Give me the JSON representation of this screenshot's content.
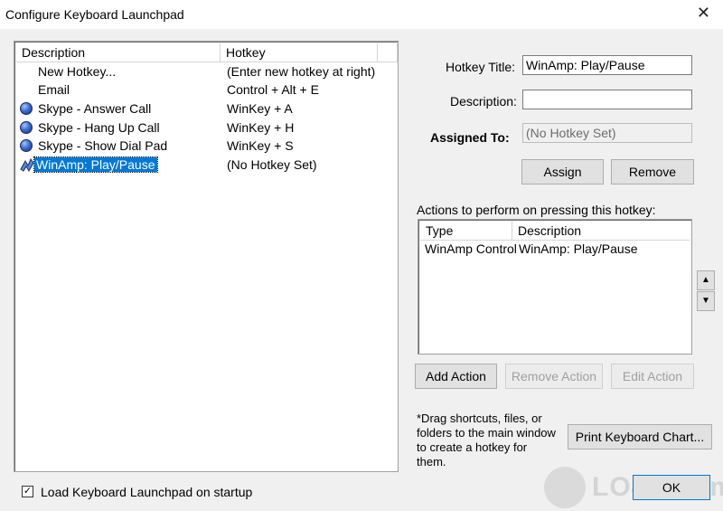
{
  "window": {
    "title": "Configure Keyboard Launchpad",
    "close_glyph": "✕"
  },
  "list": {
    "headers": [
      "Description",
      "Hotkey"
    ],
    "rows": [
      {
        "icon": "none",
        "description": "New Hotkey...",
        "hotkey": "(Enter new hotkey at right)"
      },
      {
        "icon": "none",
        "description": "Email",
        "hotkey": "Control + Alt + E"
      },
      {
        "icon": "globe-icon",
        "description": "Skype - Answer Call",
        "hotkey": "WinKey + A"
      },
      {
        "icon": "globe-icon",
        "description": "Skype - Hang Up Call",
        "hotkey": "WinKey + H"
      },
      {
        "icon": "globe-icon",
        "description": "Skype - Show Dial Pad",
        "hotkey": "WinKey + S"
      },
      {
        "icon": "winamp-icon",
        "description": "WinAmp: Play/Pause",
        "hotkey": "(No Hotkey Set)",
        "selected": true
      }
    ]
  },
  "form": {
    "hotkey_title_label": "Hotkey Title:",
    "hotkey_title_value": "WinAmp: Play/Pause",
    "description_label": "Description:",
    "description_value": "",
    "assigned_to_label": "Assigned To:",
    "assigned_to_value": "(No Hotkey Set)",
    "assign_button": "Assign",
    "remove_button": "Remove"
  },
  "actions": {
    "caption": "Actions to perform on pressing this hotkey:",
    "headers": [
      "Type",
      "Description"
    ],
    "rows": [
      {
        "type": "WinAmp Control",
        "description": "WinAmp: Play/Pause"
      }
    ],
    "add_button": "Add Action",
    "remove_button": "Remove Action",
    "edit_button": "Edit Action",
    "up_glyph": "▲",
    "down_glyph": "▼"
  },
  "hint": {
    "line1": "*Drag shortcuts, files, or",
    "line2": "folders to the main window",
    "line3": "to create a hotkey for",
    "line4": "them."
  },
  "print_button": "Print Keyboard Chart...",
  "ok_button": "OK",
  "startup": {
    "label": "Load Keyboard Launchpad on startup",
    "checked": true,
    "check_glyph": "✓"
  },
  "watermark": {
    "text": "LO4D.com"
  },
  "colors": {
    "selection": "#0078d7",
    "window_bg": "#f0f0f0"
  }
}
